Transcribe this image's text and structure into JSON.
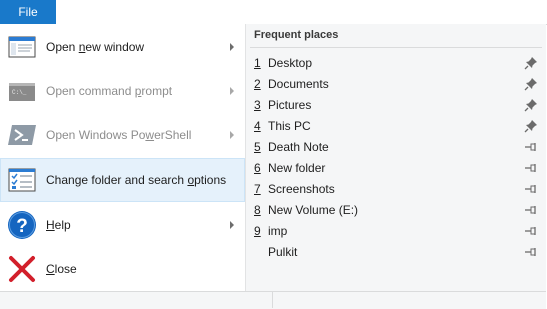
{
  "ribbon": {
    "file_tab": "File"
  },
  "menu": {
    "items": [
      {
        "label_pre": "Open ",
        "label_key": "n",
        "label_post": "ew window",
        "has_submenu": true,
        "disabled": false,
        "selected": false,
        "icon": "new-window-icon"
      },
      {
        "label_pre": "Open command ",
        "label_key": "p",
        "label_post": "rompt",
        "has_submenu": true,
        "disabled": true,
        "selected": false,
        "icon": "command-prompt-icon"
      },
      {
        "label_pre": "Open Windows Po",
        "label_key": "w",
        "label_post": "erShell",
        "has_submenu": true,
        "disabled": true,
        "selected": false,
        "icon": "powershell-icon"
      },
      {
        "label_pre": "Change folder and search ",
        "label_key": "o",
        "label_post": "ptions",
        "has_submenu": false,
        "disabled": false,
        "selected": true,
        "icon": "folder-options-icon"
      },
      {
        "label_pre": "",
        "label_key": "H",
        "label_post": "elp",
        "has_submenu": true,
        "disabled": false,
        "selected": false,
        "icon": "help-icon"
      },
      {
        "label_pre": "",
        "label_key": "C",
        "label_post": "lose",
        "has_submenu": false,
        "disabled": false,
        "selected": false,
        "icon": "close-icon"
      }
    ]
  },
  "frequent_places": {
    "title": "Frequent places",
    "items": [
      {
        "num": "1",
        "name": "Desktop",
        "pinned": true
      },
      {
        "num": "2",
        "name": "Documents",
        "pinned": true
      },
      {
        "num": "3",
        "name": "Pictures",
        "pinned": true
      },
      {
        "num": "4",
        "name": "This PC",
        "pinned": true
      },
      {
        "num": "5",
        "name": "Death Note",
        "pinned": false
      },
      {
        "num": "6",
        "name": "New folder",
        "pinned": false
      },
      {
        "num": "7",
        "name": "Screenshots",
        "pinned": false
      },
      {
        "num": "8",
        "name": "New Volume (E:)",
        "pinned": false
      },
      {
        "num": "9",
        "name": "imp",
        "pinned": false
      },
      {
        "num": "",
        "name": "Pulkit",
        "pinned": false
      }
    ]
  },
  "colors": {
    "accent": "#1979ca",
    "selected_bg": "#e5f1fb",
    "selected_border": "#cce4f7",
    "pane_bg": "#f5f6f7",
    "close_red": "#d21f2b",
    "help_blue": "#1565c0"
  }
}
